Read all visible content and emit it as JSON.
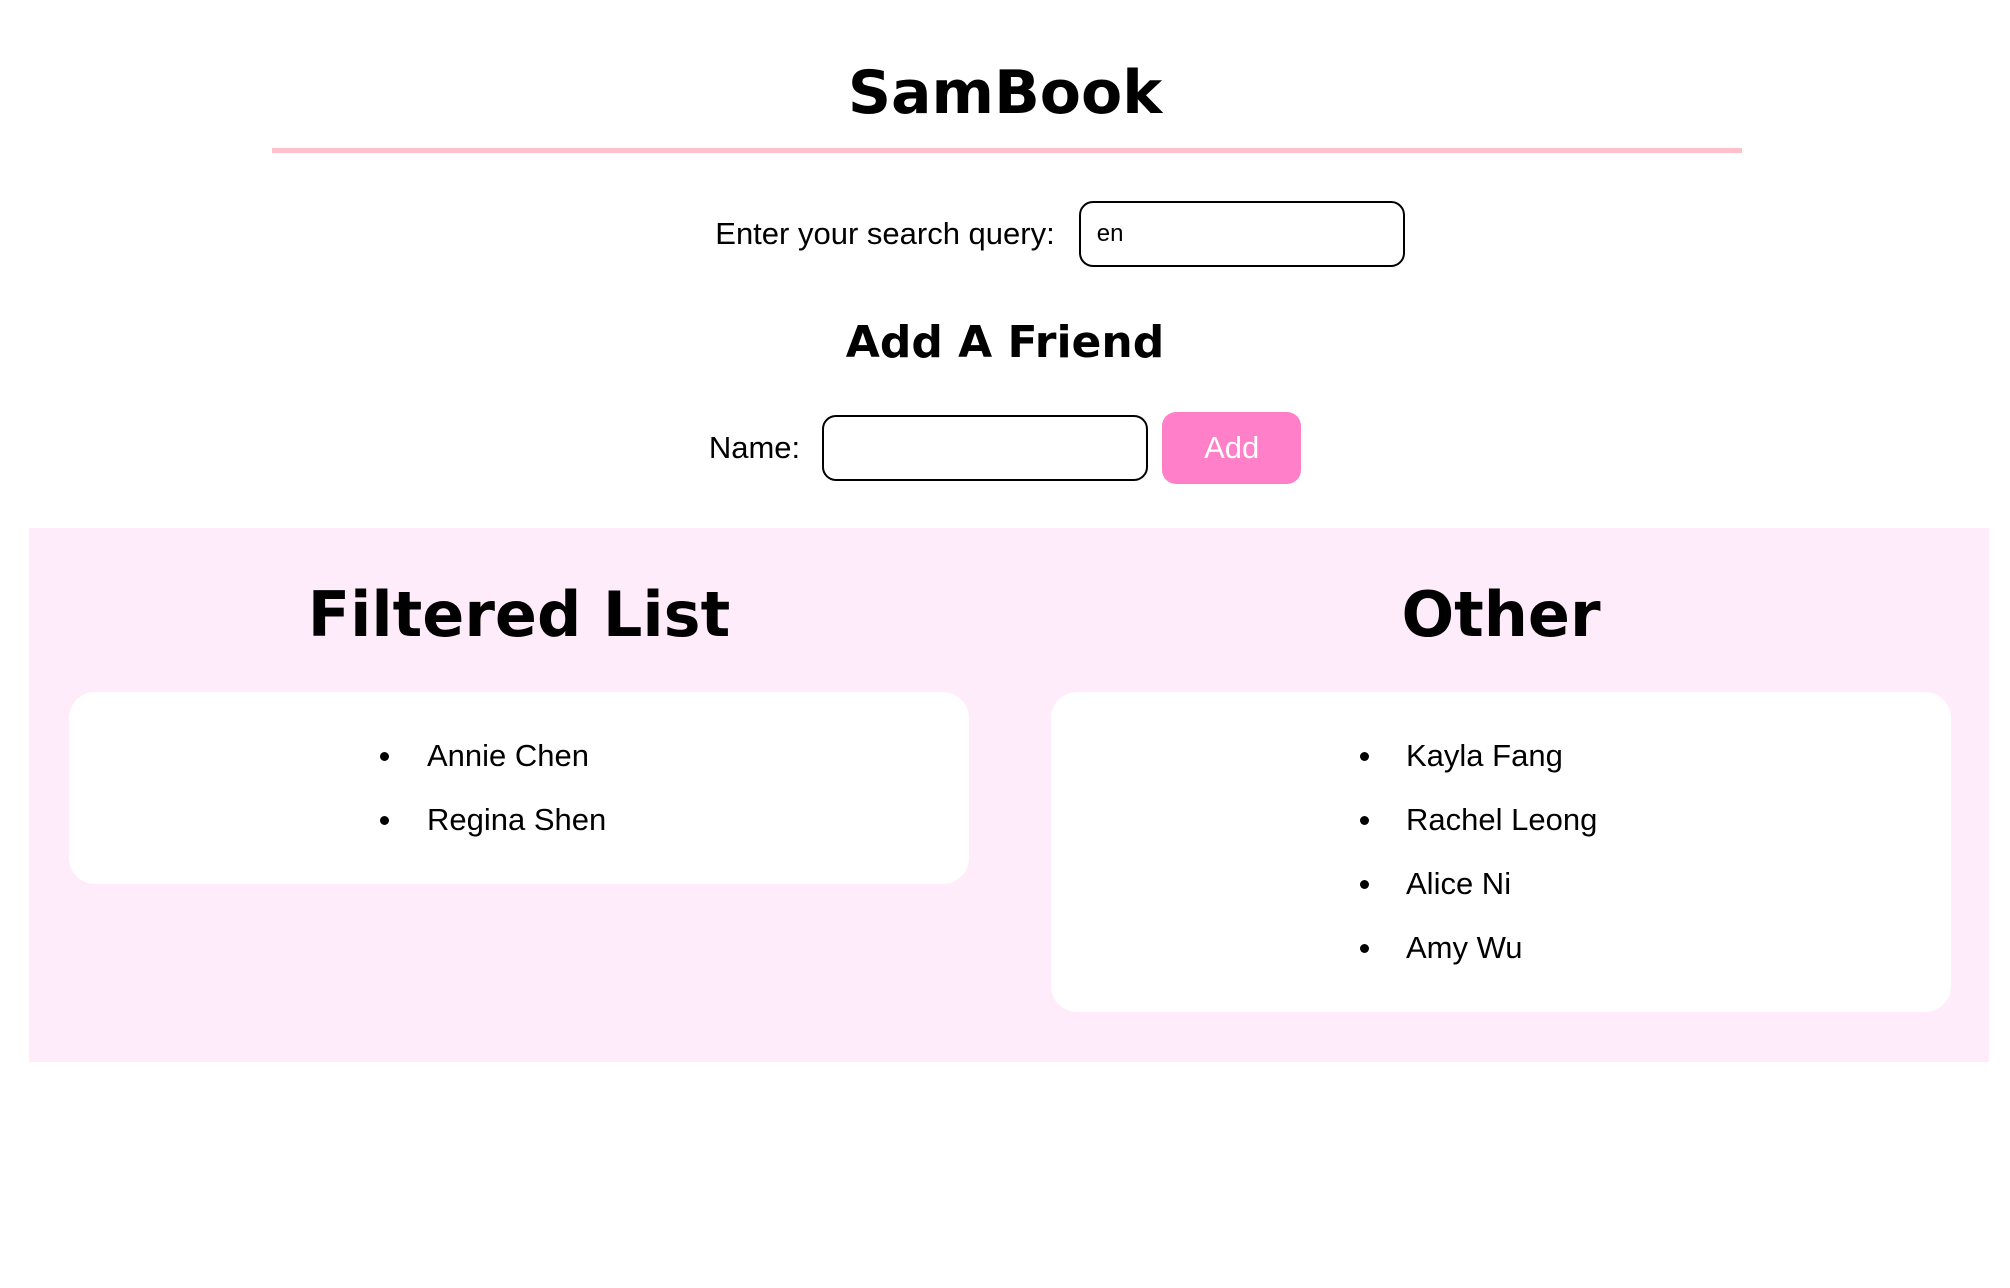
{
  "header": {
    "title": "SamBook"
  },
  "search": {
    "label": "Enter your search query:",
    "value": "en",
    "placeholder": ""
  },
  "add_friend": {
    "heading": "Add A Friend",
    "name_label": "Name:",
    "name_value": "",
    "add_label": "Add"
  },
  "filtered": {
    "heading": "Filtered List",
    "items": [
      "Annie Chen",
      "Regina Shen"
    ]
  },
  "other": {
    "heading": "Other",
    "items": [
      "Kayla Fang",
      "Rachel Leong",
      "Alice Ni",
      "Amy Wu"
    ]
  },
  "colors": {
    "accent_rule": "#ffc0cb",
    "add_button": "#ff7fc8",
    "panel_background": "#ffecfa"
  }
}
